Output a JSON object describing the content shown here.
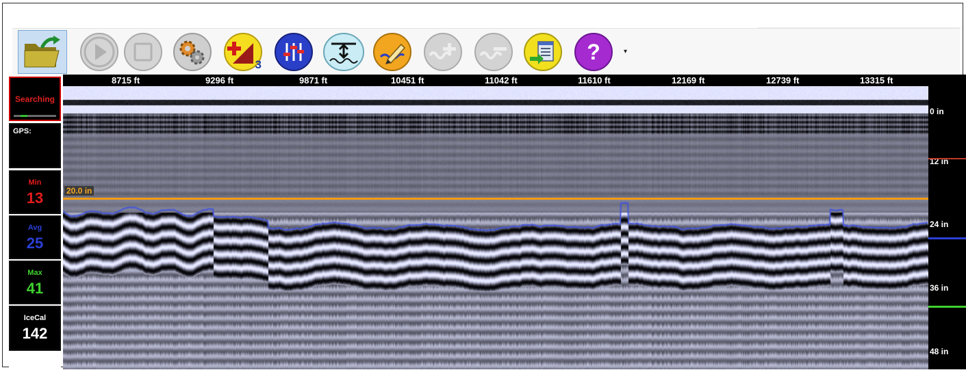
{
  "toolbar": {
    "buttons": [
      {
        "name": "open-folder-button",
        "icon": "open-folder-icon"
      },
      {
        "name": "play-button",
        "icon": "play-icon",
        "disabled": true
      },
      {
        "name": "stop-button",
        "icon": "stop-icon",
        "disabled": true
      },
      {
        "name": "settings-button",
        "icon": "gears-icon"
      },
      {
        "name": "gain-button",
        "icon": "gain-plus-icon",
        "badge": "3"
      },
      {
        "name": "equalizer-button",
        "icon": "sliders-icon"
      },
      {
        "name": "surface-align-button",
        "icon": "surface-arrow-icon"
      },
      {
        "name": "draw-button",
        "icon": "pencil-icon"
      },
      {
        "name": "zoom-in-button",
        "icon": "plus-wave-icon",
        "disabled": true
      },
      {
        "name": "zoom-out-button",
        "icon": "minus-wave-icon",
        "disabled": true
      },
      {
        "name": "export-button",
        "icon": "export-list-icon"
      },
      {
        "name": "help-button",
        "icon": "question-icon"
      }
    ],
    "dropdown_glyph": "▾"
  },
  "status": {
    "searching_label": "Searching",
    "gps_label": "GPS:",
    "min_label": "Min",
    "min_value": "13",
    "avg_label": "Avg",
    "avg_value": "25",
    "max_label": "Max",
    "max_value": "41",
    "icecal_label": "IceCal",
    "icecal_value": "142"
  },
  "colors": {
    "min": "#e31b1b",
    "avg": "#2b3fd6",
    "max": "#3fd12e",
    "icecal": "#ffffff",
    "threshold_line": "#f39c12"
  },
  "radar": {
    "distance_labels": [
      "8715 ft",
      "9296 ft",
      "9871 ft",
      "10451 ft",
      "11042 ft",
      "11610 ft",
      "12169 ft",
      "12739 ft",
      "13315 ft"
    ],
    "depth_labels": [
      "0 in",
      "12 in",
      "24 in",
      "36 in",
      "48 in"
    ],
    "threshold_label": "20.0 in",
    "threshold_depth_in": 20.0
  }
}
